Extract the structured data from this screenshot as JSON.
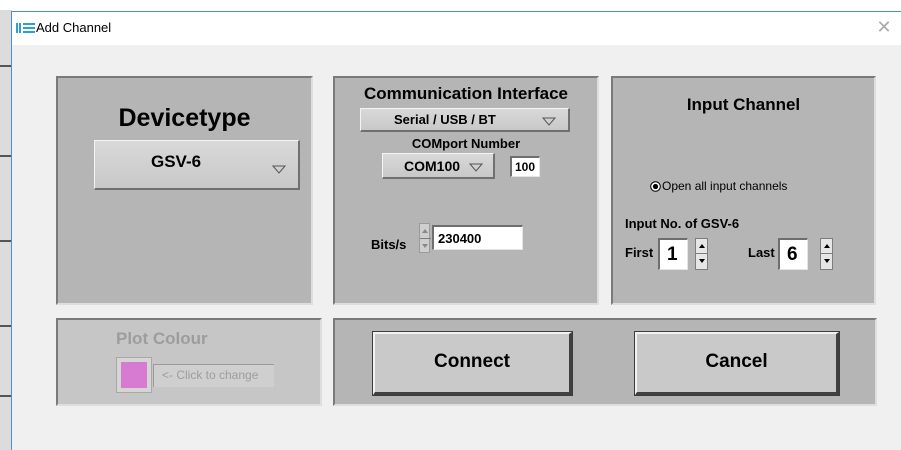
{
  "window": {
    "title": "Add Channel",
    "close_icon": "close-icon",
    "app_icon": "me-logo-icon"
  },
  "devicetype": {
    "heading": "Devicetype",
    "selected": "GSV-6"
  },
  "communication": {
    "heading": "Communication Interface",
    "interface_selected": "Serial / USB / BT",
    "comport_label": "COMport Number",
    "comport_selected": "COM100",
    "comport_value": "100",
    "bits_label": "Bits/s",
    "bits_value": "230400"
  },
  "input_channel": {
    "heading": "Input Channel",
    "radio_label": "Open all input channels",
    "radio_checked": true,
    "input_no_label": "Input No. of GSV-6",
    "first_label": "First",
    "first_value": "1",
    "last_label": "Last",
    "last_value": "6"
  },
  "plot_colour": {
    "heading": "Plot Colour",
    "swatch_color": "#d77bd2",
    "hint": "<- Click to change"
  },
  "actions": {
    "connect_label": "Connect",
    "cancel_label": "Cancel"
  },
  "colors": {
    "panel_bg": "#b5b5b5",
    "dialog_bg": "#f0f0f0",
    "accent_blue": "#4a90d9"
  }
}
